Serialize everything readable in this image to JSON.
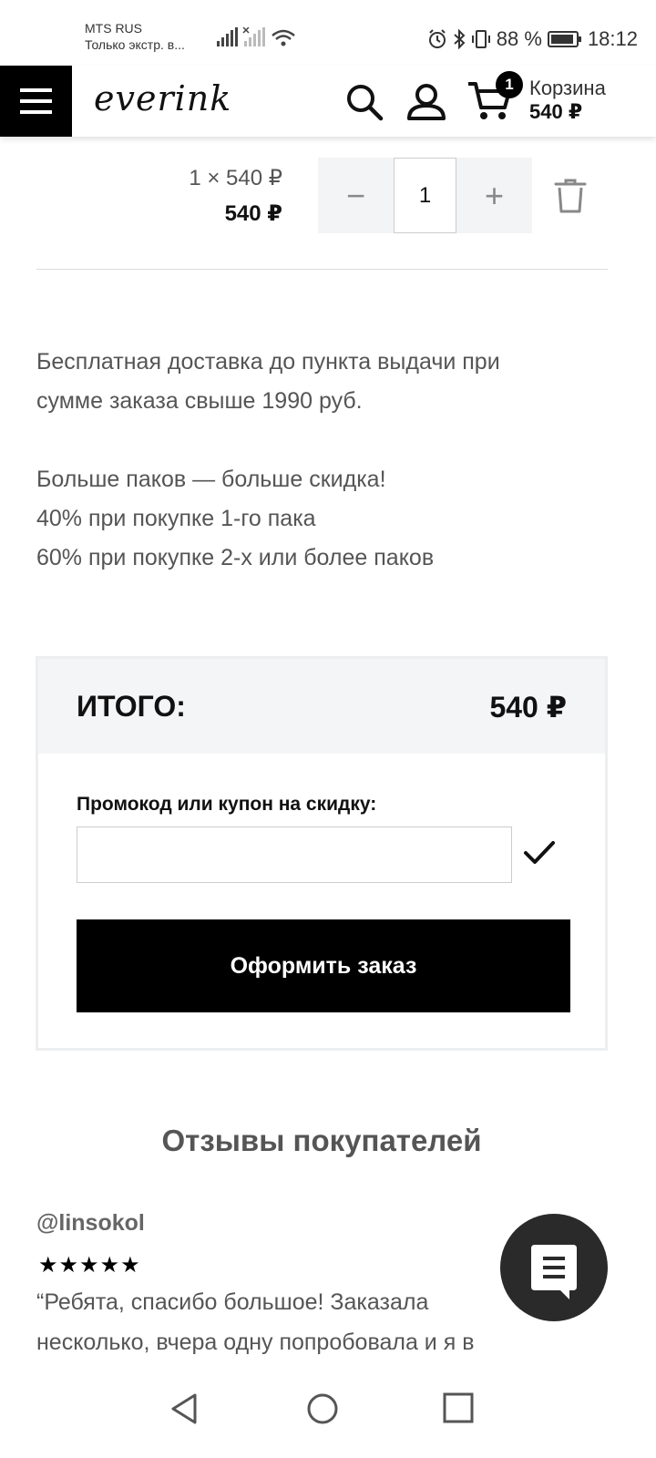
{
  "status_bar": {
    "carrier": "MTS RUS",
    "carrier_sub": "Только экстр. в...",
    "battery": "88 %",
    "time": "18:12"
  },
  "header": {
    "logo": "everink",
    "cart_count": "1",
    "cart_label": "Корзина",
    "cart_total": "540 ₽"
  },
  "cart_item": {
    "unit_price": "1 × 540 ₽",
    "line_total": "540 ₽",
    "quantity": "1",
    "minus": "−",
    "plus": "+"
  },
  "info": {
    "delivery_line1": "Бесплатная доставка до пункта выдачи при",
    "delivery_line2": "сумме заказа свыше 1990 руб.",
    "promo_line1": "Больше паков — больше скидка!",
    "promo_line2": "40% при покупке 1-го пака",
    "promo_line3": "60% при покупке 2-х или более паков"
  },
  "total": {
    "label": "ИТОГО:",
    "value": "540 ₽",
    "promo_label": "Промокод или купон на скидку:",
    "promo_value": "",
    "order_button": "Оформить заказ"
  },
  "reviews": {
    "title": "Отзывы покупателей",
    "author": "@linsokol",
    "rating": 5,
    "stars": "★★★★★",
    "text_line1": "“Ребята, спасибо большое! Заказала",
    "text_line2": "несколько, вчера одну попробовала и я в"
  }
}
